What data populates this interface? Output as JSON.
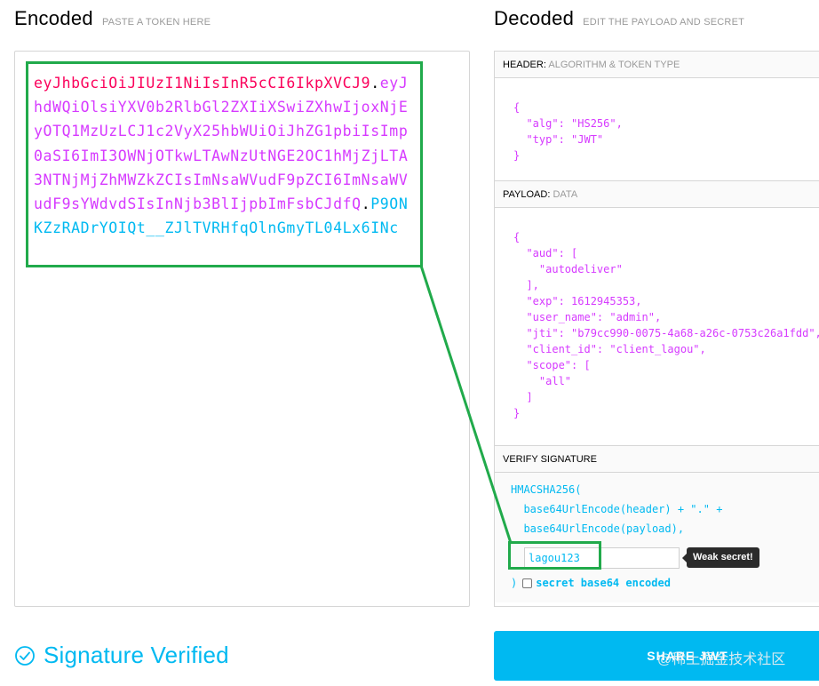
{
  "encoded": {
    "title": "Encoded",
    "subtitle": "PASTE A TOKEN HERE",
    "token_header": "eyJhbGciOiJIUzI1NiIsInR5cCI6IkpXVCJ9",
    "token_payload": "eyJhdWQiOlsiYXV0b2RlbGl2ZXIiXSwiZXhwIjoxNjEyOTQ1MzUzLCJ1c2VyX25hbWUiOiJhZG1pbiIsImp0aSI6ImI3OWNjOTkwLTAwNzUtNGE2OC1hMjZjLTA3NTNjMjZhMWZkZCIsImNsaWVudF9pZCI6ImNsaWVudF9sYWdvdSIsInNjb3BlIjpbImFsbCJdfQ",
    "token_signature": "P9ONKZzRADrYOIQt__ZJlTVRHfqOlnGmyTL04Lx6INc",
    "dot": "."
  },
  "decoded": {
    "title": "Decoded",
    "subtitle": "EDIT THE PAYLOAD AND SECRET",
    "header_label": "HEADER:",
    "header_desc": "ALGORITHM & TOKEN TYPE",
    "header_json": "{\n  \"alg\": \"HS256\",\n  \"typ\": \"JWT\"\n}",
    "payload_label": "PAYLOAD:",
    "payload_desc": "DATA",
    "payload_json": "{\n  \"aud\": [\n    \"autodeliver\"\n  ],\n  \"exp\": 1612945353,\n  \"user_name\": \"admin\",\n  \"jti\": \"b79cc990-0075-4a68-a26c-0753c26a1fdd\",\n  \"client_id\": \"client_lagou\",\n  \"scope\": [\n    \"all\"\n  ]\n}",
    "verify_label": "VERIFY SIGNATURE",
    "sig_line1": "HMACSHA256(",
    "sig_line2": "  base64UrlEncode(header) + \".\" +",
    "sig_line3": "  base64UrlEncode(payload),",
    "secret_value": "lagou123",
    "tooltip": "Weak secret!",
    "close_paren": ")",
    "base64_label": "secret base64 encoded"
  },
  "status": {
    "verified_text": "Signature Verified"
  },
  "share_button": {
    "label": "SHARE JWT"
  },
  "watermark": "@稀土掘金技术社区",
  "colors": {
    "header": "#fb015b",
    "payload": "#d63aff",
    "signature": "#00b9f1",
    "highlight": "#21aa4b"
  }
}
